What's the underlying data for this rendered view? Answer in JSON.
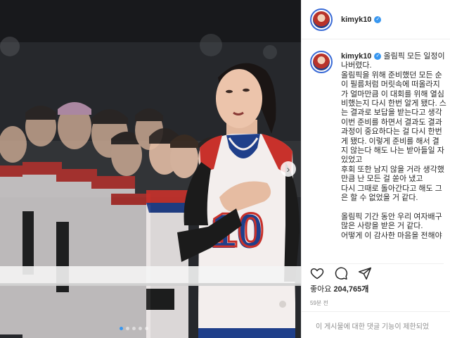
{
  "post": {
    "username": "kimyk10",
    "verified": true,
    "caption_lines": [
      "올림픽 모든 일정이",
      "나버렸다.",
      "올림픽을 위해 준비했던 모든 순",
      "이 필름처럼 머릿속에 떠올라지",
      "가 얼마만큼 이 대회를 위해 열심",
      "비했는지 다시 한번 알게 됐다. 스",
      "는 결과로 보답을 받는다고 생각",
      "이번 준비를 하면서 결과도 결과",
      "과정이 중요하다는 걸 다시 한번",
      "게 됐다. 이렇게 준비를 해서 결",
      "지 않는다 해도 나는 받아들일 자",
      "있었고",
      "후회 또한 남지 않을 거라 생각했",
      "만큼 난 모든 걸 쏟아 냈고",
      "다시 그때로 돌아간다고 해도 그",
      "은 할 수 없었을 거 같다.",
      "",
      "올림픽 기간 동안 우리 여자배구",
      "많은 사랑을 받은 거 같다.",
      "어떻게 이 감사한 마음을 전해야"
    ],
    "likes_label": "좋아요",
    "likes_count": "204,765개",
    "time_ago": "59분 전",
    "comments_disabled_text": "이 게시물에 대한 댓글 기능이 제한되었"
  },
  "icons": {
    "like": "heart-icon",
    "comment": "comment-icon",
    "share": "send-icon",
    "next": "chevron-right-icon",
    "verified": "verified-badge-icon"
  },
  "colors": {
    "verified_blue": "#3897f0",
    "text_dark": "#262626",
    "text_muted": "#8e8e8e",
    "divider": "#efefef",
    "jersey_red": "#c8312b",
    "jersey_navy": "#1f3f8a"
  },
  "carousel": {
    "total": 5,
    "active": 1
  },
  "photo": {
    "jersey_number": "10"
  }
}
